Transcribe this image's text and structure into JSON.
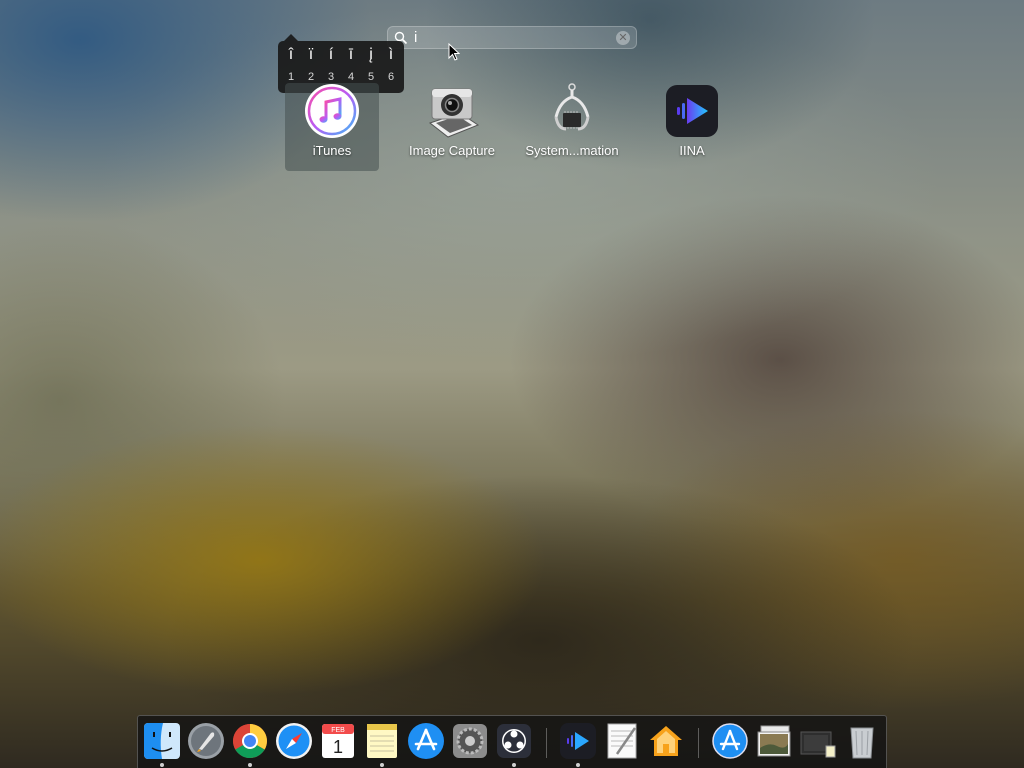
{
  "search": {
    "query": "i",
    "clear_label": "✕"
  },
  "accent_popover": {
    "options": [
      {
        "char": "î",
        "num": "1"
      },
      {
        "char": "ï",
        "num": "2"
      },
      {
        "char": "í",
        "num": "3"
      },
      {
        "char": "ī",
        "num": "4"
      },
      {
        "char": "į",
        "num": "5"
      },
      {
        "char": "ì",
        "num": "6"
      }
    ]
  },
  "apps": [
    {
      "label": "iTunes",
      "icon": "itunes-icon",
      "selected": true
    },
    {
      "label": "Image Capture",
      "icon": "image-capture-icon"
    },
    {
      "label": "System...mation",
      "icon": "system-information-icon"
    },
    {
      "label": "IINA",
      "icon": "iina-icon"
    }
  ],
  "dock": {
    "items": [
      {
        "icon": "finder-icon",
        "running": true
      },
      {
        "icon": "launchpad-icon",
        "running": false
      },
      {
        "icon": "chrome-icon",
        "running": true
      },
      {
        "icon": "safari-icon",
        "running": false
      },
      {
        "icon": "calendar-icon",
        "running": false,
        "month": "FEB",
        "day": "1"
      },
      {
        "icon": "notes-icon",
        "running": true
      },
      {
        "icon": "app-store-icon",
        "running": false
      },
      {
        "icon": "system-preferences-icon",
        "running": false
      },
      {
        "icon": "obs-icon",
        "running": true
      },
      {
        "icon": "iina-icon",
        "running": true
      },
      {
        "icon": "textedit-icon",
        "running": false
      },
      {
        "icon": "home-icon",
        "running": false
      },
      {
        "icon": "applications-folder-icon",
        "running": false
      },
      {
        "icon": "pictures-stack-icon",
        "running": false
      },
      {
        "icon": "downloads-stack-icon",
        "running": false
      },
      {
        "icon": "trash-icon",
        "running": false
      }
    ]
  },
  "colors": {
    "iina_blue": "#2aa7ff",
    "selection_bg": "#46504f",
    "dock_bg": "#141414"
  }
}
